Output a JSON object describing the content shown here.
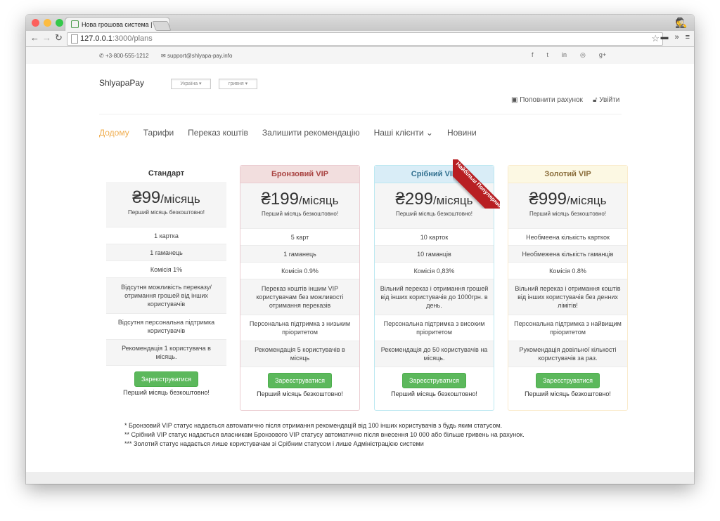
{
  "browser": {
    "tab_title": "Нова грошова система | S",
    "tab_close": "✕",
    "url_host": "127.0.0.1",
    "url_path": ":3000/plans"
  },
  "topbar": {
    "phone": "+3-800-555-1212",
    "email": "support@shlyapa-pay.info",
    "socials": [
      "facebook-icon",
      "twitter-icon",
      "linkedin-icon",
      "dribbble-icon",
      "google-plus-icon"
    ]
  },
  "header": {
    "brand": "ShlyapaPay",
    "country_dropdown": "Україна ▾",
    "currency_dropdown": "гривня ▾",
    "topup_label": "Поповнити рахунок",
    "login_label": "Увійти"
  },
  "nav": {
    "items": [
      {
        "label": "Додому"
      },
      {
        "label": "Тарифи"
      },
      {
        "label": "Переказ коштів"
      },
      {
        "label": "Залишити рекомендацію"
      },
      {
        "label": "Наші клієнти ⌄"
      },
      {
        "label": "Новини"
      }
    ]
  },
  "plans": [
    {
      "name": "Стандарт",
      "price": "₴99",
      "period": "/місяць",
      "subtitle": "Перший місяць безкоштовно!",
      "features": [
        "1 картка",
        "1 гаманець",
        "Комісія 1%",
        "Відсутня можливість переказу/ отримання грошей від інших користувачів",
        "Відсутня персональна підтримка користувачів",
        "Рекомендація 1 користувача в місяць."
      ],
      "button": "Зареєструватися",
      "footer": "Перший місяць безкоштовно!"
    },
    {
      "name": "Бронзовий VIP",
      "price": "₴199",
      "period": "/місяць",
      "subtitle": "Перший місяць безкоштовно!",
      "features": [
        "5 карт",
        "1 гаманець",
        "Комісія 0.9%",
        "Переказ коштів іншим VIP користувачам без можливості отримання переказів",
        "Персональна підтримка з низьким пріоритетом",
        "Рекомендація 5 користувачів в місяць"
      ],
      "button": "Зареєструватися",
      "footer": "Перший місяць безкоштовно!"
    },
    {
      "name": "Срібний VIP",
      "price": "₴299",
      "period": "/місяць",
      "subtitle": "Перший місяць безкоштовно!",
      "features": [
        "10 карток",
        "10 гаманців",
        "Комісія 0,83%",
        "Вільний переказ і отримання грошей від інших користувачів до 1000грн. в день.",
        "Персональна підтримка з високим пріоритетом",
        "Рекомендація до 50 користувачів на місяць."
      ],
      "button": "Зареєструватися",
      "footer": "Перший місяць безкоштовно!",
      "ribbon": "Найбільш Популярний"
    },
    {
      "name": "Золотий VIP",
      "price": "₴999",
      "period": "/місяць",
      "subtitle": "Перший місяць безкоштовно!",
      "features": [
        "Необмеена кількість карткок",
        "Необмежена кількість гаманців",
        "Комісія 0.8%",
        "Вільний переказ і отримання коштів від інших користувачів без денних лімітів!",
        "Персональна підтримка з найвищим пріоритетом",
        "Рукомендація довільної кількості користувачів за раз."
      ],
      "button": "Зареєструватися",
      "footer": "Перший місяць безкоштовно!"
    }
  ],
  "notes": [
    "* Бронзовий VIP статус надається автоматично після отримання рекомендацій від 100 інших користувачів з будь яким статусом.",
    "** Срібний VIP статус надається власникам Бронзового VIP статусу автоматично після внесення 10 000 або більше гривень на рахунок.",
    "*** Золотий статус надається лише користувачам зі Срібним статусом і лише Адміністрацією системи"
  ],
  "colors": {
    "accent_nav": "#f0ad4e",
    "button_green": "#5cb85c",
    "ribbon_red": "#b81f23"
  }
}
